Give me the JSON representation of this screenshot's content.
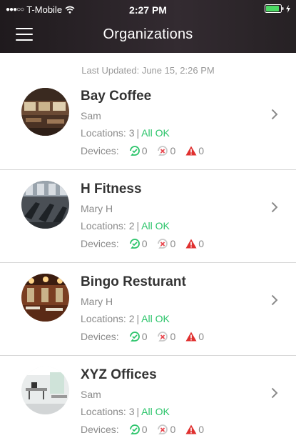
{
  "status_bar": {
    "signal_dots": "●●●○○",
    "carrier": "T-Mobile",
    "time": "2:27 PM",
    "wifi_icon": "wifi-icon",
    "battery_icon": "battery-icon"
  },
  "header": {
    "title": "Organizations",
    "menu_icon": "hamburger-menu-icon",
    "background_color": "#2b2428"
  },
  "last_updated": "Last Updated: June 15, 2:26 PM",
  "colors": {
    "ok_green": "#2bc46a",
    "online_icon": "#2bc46a",
    "offline_icon": "#e8484f",
    "alert_icon": "#e0302f"
  },
  "devices_label": "Devices:",
  "organizations": [
    {
      "name": "Bay Coffee",
      "owner": "Sam",
      "locations_text": "Locations: 3",
      "separator": "|",
      "status": "All OK",
      "online": "0",
      "offline": "0",
      "alerts": "0"
    },
    {
      "name": "H Fitness",
      "owner": "Mary H",
      "locations_text": "Locations: 2",
      "separator": "|",
      "status": "All OK",
      "online": "0",
      "offline": "0",
      "alerts": "0"
    },
    {
      "name": "Bingo Resturant",
      "owner": "Mary H",
      "locations_text": "Locations: 2",
      "separator": "|",
      "status": "All OK",
      "online": "0",
      "offline": "0",
      "alerts": "0"
    },
    {
      "name": "XYZ Offices",
      "owner": "Sam",
      "locations_text": "Locations: 3",
      "separator": "|",
      "status": "All OK",
      "online": "0",
      "offline": "0",
      "alerts": "0"
    }
  ]
}
